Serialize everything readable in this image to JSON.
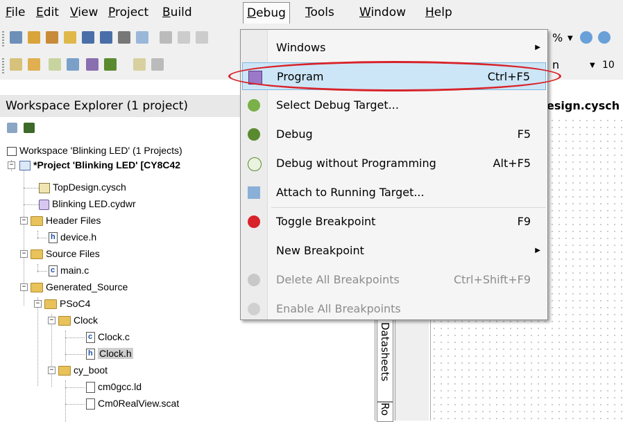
{
  "menubar": {
    "items": [
      "File",
      "Edit",
      "View",
      "Project",
      "Build",
      "Debug",
      "Tools",
      "Window",
      "Help"
    ]
  },
  "toolbar2": {
    "zoom_partial": "%",
    "font_size": "10",
    "partial_n": "n"
  },
  "workspace": {
    "header": "Workspace Explorer (1 project)",
    "tree": [
      "Workspace 'Blinking LED' (1 Projects)",
      "*Project 'Blinking LED' [CY8C42",
      "TopDesign.cysch",
      "Blinking LED.cydwr",
      "Header Files",
      "device.h",
      "Source Files",
      "main.c",
      "Generated_Source",
      "PSoC4",
      "Clock",
      "Clock.c",
      "Clock.h",
      "cy_boot",
      "cm0gcc.ld",
      "Cm0RealView.scat"
    ]
  },
  "editor": {
    "tab_partial": "esign.cysch",
    "datasheets_tab": "Datasheets",
    "ro_tab": "Ro"
  },
  "debug_menu": {
    "items": [
      {
        "label": "Windows",
        "shortcut": "",
        "submenu": true,
        "icon": "none"
      },
      {
        "label": "Program",
        "shortcut": "Ctrl+F5",
        "icon": "chip-program-icon"
      },
      {
        "label": "Select Debug Target...",
        "shortcut": "",
        "icon": "bug-target-icon"
      },
      {
        "label": "Debug",
        "shortcut": "F5",
        "icon": "bug-icon"
      },
      {
        "label": "Debug without Programming",
        "shortcut": "Alt+F5",
        "icon": "bug-outline-icon"
      },
      {
        "label": "Attach to Running Target...",
        "shortcut": "",
        "icon": "attach-icon"
      },
      {
        "label": "Toggle Breakpoint",
        "shortcut": "F9",
        "icon": "breakpoint-icon"
      },
      {
        "label": "New Breakpoint",
        "shortcut": "",
        "submenu": true,
        "icon": "none"
      },
      {
        "label": "Delete All Breakpoints",
        "shortcut": "Ctrl+Shift+F9",
        "disabled": true,
        "icon": "delete-breakpoints-icon"
      },
      {
        "label": "Enable All Breakpoints",
        "shortcut": "",
        "disabled": true,
        "icon": "enable-breakpoints-icon"
      }
    ]
  },
  "colors": {
    "highlight": "#cde6f7",
    "annotation": "#d8232a",
    "folder": "#e8c25a"
  }
}
